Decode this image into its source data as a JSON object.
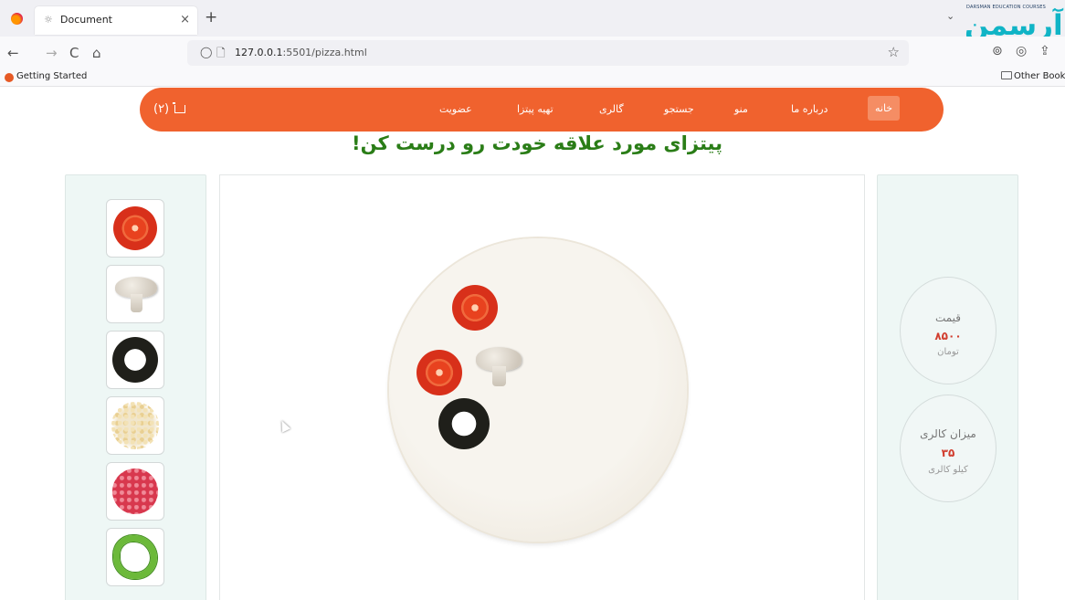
{
  "browser": {
    "tab_title": "Document",
    "tab_icon": "☼",
    "tab_close": "×",
    "new_tab": "+",
    "tab_list": "⌄",
    "url_host": "127.0.0.1",
    "url_rest": ":5501/pizza.html",
    "bookmark": "Getting Started",
    "other_bookmarks": "Other Bookm",
    "nav": {
      "back": "←",
      "forward": "→",
      "reload": "C",
      "home": "⌂",
      "shield": "◯",
      "page": "🗋",
      "star": "☆"
    },
    "right_icons": [
      "⊚",
      "◎",
      "⇪"
    ],
    "brand_caption": "DARSMAN EDUCATION COURSES",
    "brand_mark": "آرسمن"
  },
  "site": {
    "cart": "(۲)",
    "menu": [
      "خانه",
      "درباره ما",
      "منو",
      "جستجو",
      "گالری",
      "تهیه پیتزا",
      "عضویت"
    ],
    "headline": "پیتزای مورد علاقه خودت رو درست کن!"
  },
  "ingredients": [
    "tomato",
    "mushroom",
    "olive",
    "cheese",
    "salami",
    "bell-pepper"
  ],
  "toppings_on_pizza": [
    "tomato",
    "tomato",
    "mushroom",
    "olive"
  ],
  "stats": {
    "price": {
      "title": "قیمت",
      "value": "۸۵۰۰",
      "unit": "تومان"
    },
    "calories": {
      "title": "میزان کالری",
      "value": "۳۵",
      "unit": "کیلو کالری"
    }
  },
  "colors": {
    "nav": "#f0622e",
    "active_menu": "#f58d64",
    "headline": "#2a7d17",
    "stat_value": "#d13d2e",
    "panel": "#eef7f5"
  }
}
